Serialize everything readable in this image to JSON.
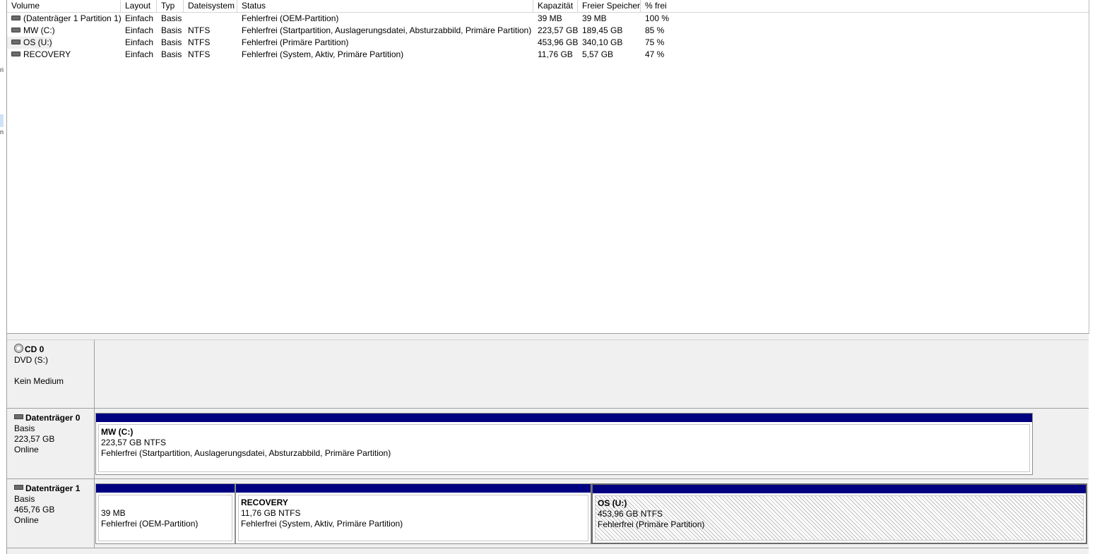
{
  "columns": [
    "Volume",
    "Layout",
    "Typ",
    "Dateisystem",
    "Status",
    "Kapazität",
    "Freier Speicher",
    "% frei"
  ],
  "volumes": [
    {
      "volume": "(Datenträger 1 Partition 1)",
      "layout": "Einfach",
      "typ": "Basis",
      "fs": "",
      "status": "Fehlerfrei (OEM-Partition)",
      "kap": "39 MB",
      "frei": "39 MB",
      "pct": "100 %"
    },
    {
      "volume": "MW (C:)",
      "layout": "Einfach",
      "typ": "Basis",
      "fs": "NTFS",
      "status": "Fehlerfrei (Startpartition, Auslagerungsdatei, Absturzabbild, Primäre Partition)",
      "kap": "223,57 GB",
      "frei": "189,45 GB",
      "pct": "85 %"
    },
    {
      "volume": "OS (U:)",
      "layout": "Einfach",
      "typ": "Basis",
      "fs": "NTFS",
      "status": "Fehlerfrei (Primäre Partition)",
      "kap": "453,96 GB",
      "frei": "340,10 GB",
      "pct": "75 %"
    },
    {
      "volume": "RECOVERY",
      "layout": "Einfach",
      "typ": "Basis",
      "fs": "NTFS",
      "status": "Fehlerfrei (System, Aktiv, Primäre Partition)",
      "kap": "11,76 GB",
      "frei": "5,57 GB",
      "pct": "47 %"
    }
  ],
  "disks": {
    "cd0": {
      "name": "CD 0",
      "line1": "DVD (S:)",
      "line2": "Kein Medium"
    },
    "disk0": {
      "name": "Datenträger 0",
      "type": "Basis",
      "size": "223,57 GB",
      "state": "Online",
      "partitions": [
        {
          "title": "MW  (C:)",
          "size": "223,57 GB NTFS",
          "status": "Fehlerfrei (Startpartition, Auslagerungsdatei, Absturzabbild, Primäre Partition)"
        }
      ]
    },
    "disk1": {
      "name": "Datenträger 1",
      "type": "Basis",
      "size": "465,76 GB",
      "state": "Online",
      "partitions": [
        {
          "title": "",
          "size": "39 MB",
          "status": "Fehlerfrei (OEM-Partition)"
        },
        {
          "title": "RECOVERY",
          "size": "11,76 GB NTFS",
          "status": "Fehlerfrei (System, Aktiv, Primäre Partition)"
        },
        {
          "title": "OS  (U:)",
          "size": "453,96 GB NTFS",
          "status": "Fehlerfrei (Primäre Partition)"
        }
      ]
    }
  },
  "colors": {
    "partition_bar": "#000080",
    "panel_bg": "#f0f0f0"
  }
}
